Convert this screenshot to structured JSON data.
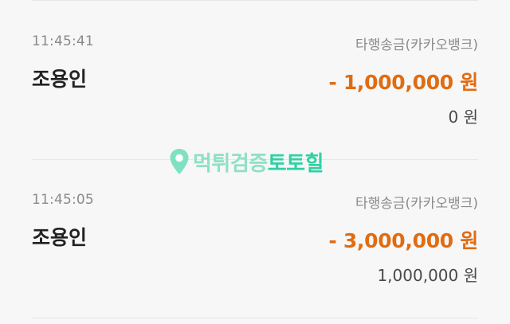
{
  "transactions": [
    {
      "time": "11:45:41",
      "type": "타행송금(카카오뱅크)",
      "name": "조용인",
      "amount": "- 1,000,000 원",
      "balance": "0 원"
    },
    {
      "time": "11:45:05",
      "type": "타행송금(카카오뱅크)",
      "name": "조용인",
      "amount": "- 3,000,000 원",
      "balance": "1,000,000 원"
    }
  ],
  "watermark": {
    "text_primary": "먹튀검증",
    "text_brand": "토토힐",
    "icon": "location-pin-icon"
  },
  "colors": {
    "amount": "#e06c12",
    "watermark_light": "#8ee0c4",
    "watermark_dark": "#2fd0a4"
  }
}
